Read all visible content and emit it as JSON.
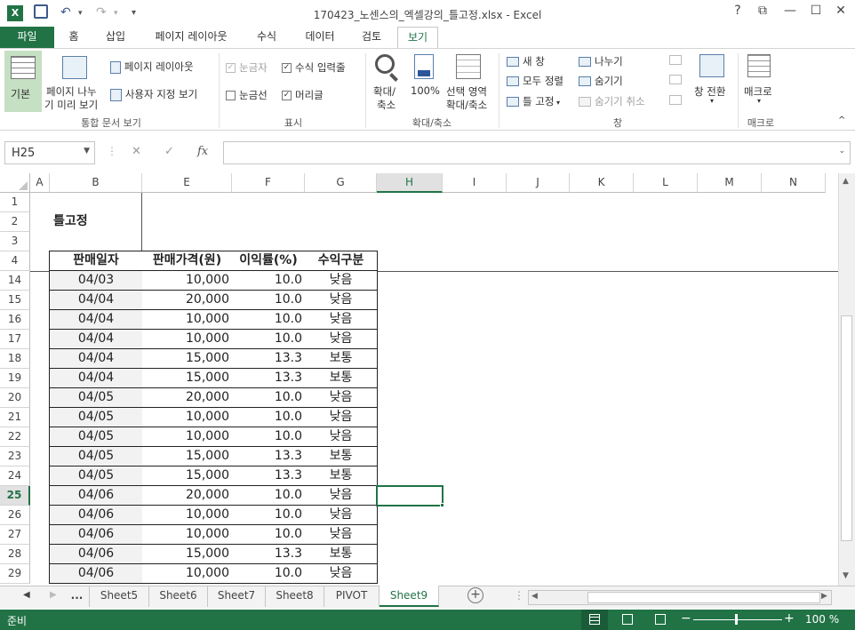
{
  "window": {
    "title": "170423_노센스의_엑셀강의_틀고정.xlsx - Excel",
    "help": "?",
    "restore": "⧉",
    "minimize": "—",
    "maximize": "☐",
    "close": "✕"
  },
  "quick_access": {
    "save_icon": "save-icon",
    "undo_icon": "undo-icon",
    "redo_icon": "redo-icon",
    "customize_icon": "customize-icon"
  },
  "tabs": [
    "파일",
    "홈",
    "삽입",
    "페이지 레이아웃",
    "수식",
    "데이터",
    "검토",
    "보기"
  ],
  "ribbon": {
    "workbook_views": {
      "normal": "기본",
      "page_break_1": "페이지 나누",
      "page_break_2": "기 미리 보기",
      "page_layout": "페이지 레이아웃",
      "custom": "사용자 지정 보기",
      "group": "통합 문서 보기"
    },
    "show": {
      "ruler": "눈금자",
      "formula_bar": "수식 입력줄",
      "gridlines": "눈금선",
      "headings": "머리글",
      "group": "표시"
    },
    "zoom": {
      "zoom_1": "확대/",
      "zoom_2": "축소",
      "hundred": "100%",
      "selection_1": "선택 영역",
      "selection_2": "확대/축소",
      "group": "확대/축소"
    },
    "window": {
      "new_window": "새 창",
      "arrange_all": "모두 정렬",
      "freeze": "틀 고정",
      "split": "나누기",
      "hide": "숨기기",
      "unhide": "숨기기 취소",
      "switch": "창 전환",
      "group": "창"
    },
    "macros": {
      "macros": "매크로",
      "group": "매크로"
    }
  },
  "formula_bar": {
    "name_box": "H25",
    "cancel": "✕",
    "enter": "✓",
    "fx": "fx",
    "value": ""
  },
  "columns": [
    "A",
    "B",
    "E",
    "F",
    "G",
    "H",
    "I",
    "J",
    "K",
    "L",
    "M",
    "N"
  ],
  "selected_column": "H",
  "sheet_title": "틀고정",
  "table_headers": [
    "판매일자",
    "판매가격(원)",
    "이익률(%)",
    "수익구분"
  ],
  "frozen_rows": [
    "1",
    "2",
    "3",
    "4"
  ],
  "rows": [
    {
      "n": "14",
      "date": "04/03",
      "price": "10,000",
      "rate": "10.0",
      "cat": "낮음"
    },
    {
      "n": "15",
      "date": "04/04",
      "price": "20,000",
      "rate": "10.0",
      "cat": "낮음"
    },
    {
      "n": "16",
      "date": "04/04",
      "price": "10,000",
      "rate": "10.0",
      "cat": "낮음"
    },
    {
      "n": "17",
      "date": "04/04",
      "price": "10,000",
      "rate": "10.0",
      "cat": "낮음"
    },
    {
      "n": "18",
      "date": "04/04",
      "price": "15,000",
      "rate": "13.3",
      "cat": "보통"
    },
    {
      "n": "19",
      "date": "04/04",
      "price": "15,000",
      "rate": "13.3",
      "cat": "보통"
    },
    {
      "n": "20",
      "date": "04/05",
      "price": "20,000",
      "rate": "10.0",
      "cat": "낮음"
    },
    {
      "n": "21",
      "date": "04/05",
      "price": "10,000",
      "rate": "10.0",
      "cat": "낮음"
    },
    {
      "n": "22",
      "date": "04/05",
      "price": "10,000",
      "rate": "10.0",
      "cat": "낮음"
    },
    {
      "n": "23",
      "date": "04/05",
      "price": "15,000",
      "rate": "13.3",
      "cat": "보통"
    },
    {
      "n": "24",
      "date": "04/05",
      "price": "15,000",
      "rate": "13.3",
      "cat": "보통"
    },
    {
      "n": "25",
      "date": "04/06",
      "price": "20,000",
      "rate": "10.0",
      "cat": "낮음"
    },
    {
      "n": "26",
      "date": "04/06",
      "price": "10,000",
      "rate": "10.0",
      "cat": "낮음"
    },
    {
      "n": "27",
      "date": "04/06",
      "price": "10,000",
      "rate": "10.0",
      "cat": "낮음"
    },
    {
      "n": "28",
      "date": "04/06",
      "price": "15,000",
      "rate": "13.3",
      "cat": "보통"
    },
    {
      "n": "29",
      "date": "04/06",
      "price": "10,000",
      "rate": "10.0",
      "cat": "낮음"
    }
  ],
  "selected_row": "25",
  "sheet_tabs": {
    "more": "...",
    "tabs": [
      "Sheet5",
      "Sheet6",
      "Sheet7",
      "Sheet8",
      "PIVOT",
      "Sheet9"
    ],
    "active": "Sheet9",
    "add": "+"
  },
  "status": {
    "ready": "준비",
    "zoom": "100 %",
    "minus": "−",
    "plus": "+"
  },
  "colors": {
    "accent": "#217346",
    "selection": "#217346"
  }
}
